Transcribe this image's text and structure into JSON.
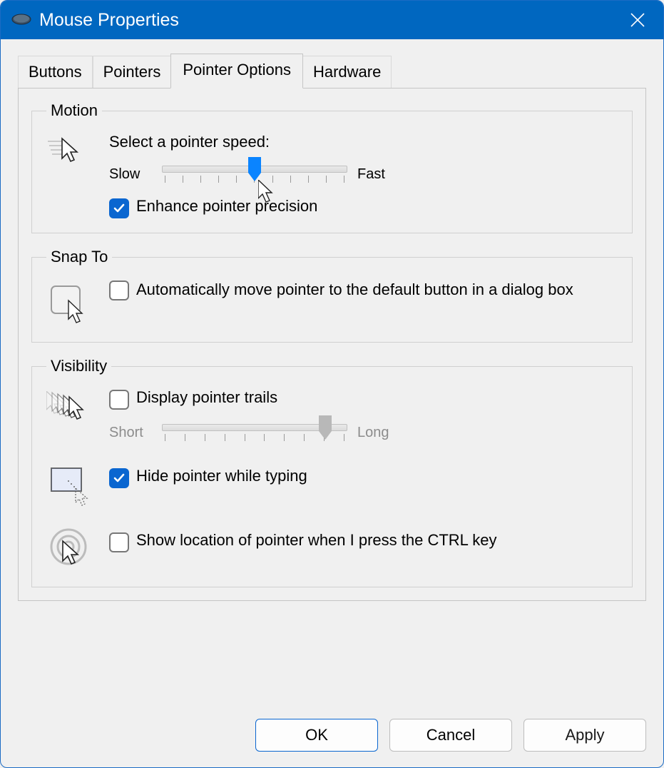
{
  "window": {
    "title": "Mouse Properties"
  },
  "tabs": [
    {
      "label": "Buttons",
      "active": false
    },
    {
      "label": "Pointers",
      "active": false
    },
    {
      "label": "Pointer Options",
      "active": true
    },
    {
      "label": "Hardware",
      "active": false
    }
  ],
  "motion": {
    "legend": "Motion",
    "speed_label": "Select a pointer speed:",
    "slow_label": "Slow",
    "fast_label": "Fast",
    "speed_value": 6,
    "speed_min": 1,
    "speed_max": 11,
    "enhance_precision": {
      "checked": true,
      "label": "Enhance pointer precision"
    }
  },
  "snap_to": {
    "legend": "Snap To",
    "auto_move": {
      "checked": false,
      "label": "Automatically move pointer to the default button in a dialog box"
    }
  },
  "visibility": {
    "legend": "Visibility",
    "trails": {
      "checked": false,
      "label": "Display pointer trails",
      "short_label": "Short",
      "long_label": "Long",
      "trail_value": 9,
      "trail_min": 1,
      "trail_max": 10,
      "enabled": false
    },
    "hide_typing": {
      "checked": true,
      "label": "Hide pointer while typing"
    },
    "show_ctrl": {
      "checked": false,
      "label": "Show location of pointer when I press the CTRL key"
    }
  },
  "footer": {
    "ok": "OK",
    "cancel": "Cancel",
    "apply": "Apply"
  }
}
